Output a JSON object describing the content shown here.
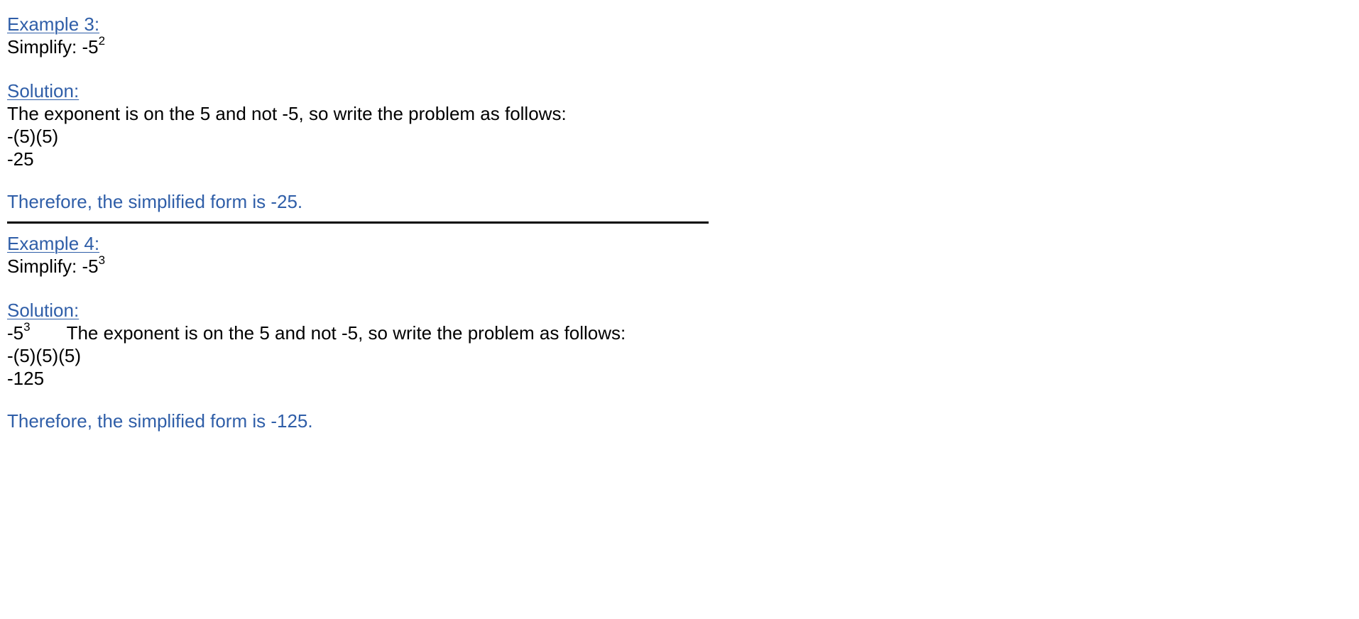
{
  "examples": [
    {
      "heading": "Example 3:",
      "problem_prefix": "Simplify:  -5",
      "problem_exponent": "2",
      "solution_heading": "Solution:",
      "explanation": "The exponent is on the 5 and not -5, so write the problem as follows:",
      "step1": "-(5)(5)",
      "step2": "-25",
      "conclusion": "Therefore, the simplified form is -25."
    },
    {
      "heading": "Example 4:",
      "problem_prefix": "Simplify:  -5",
      "problem_exponent": "3",
      "solution_heading": "Solution:",
      "inline_base": "-5",
      "inline_exponent": "3",
      "explanation": "The exponent is on the 5 and not -5, so write the problem as follows:",
      "step1": "-(5)(5)(5)",
      "step2": "-125",
      "conclusion": "Therefore, the simplified form is -125."
    }
  ]
}
